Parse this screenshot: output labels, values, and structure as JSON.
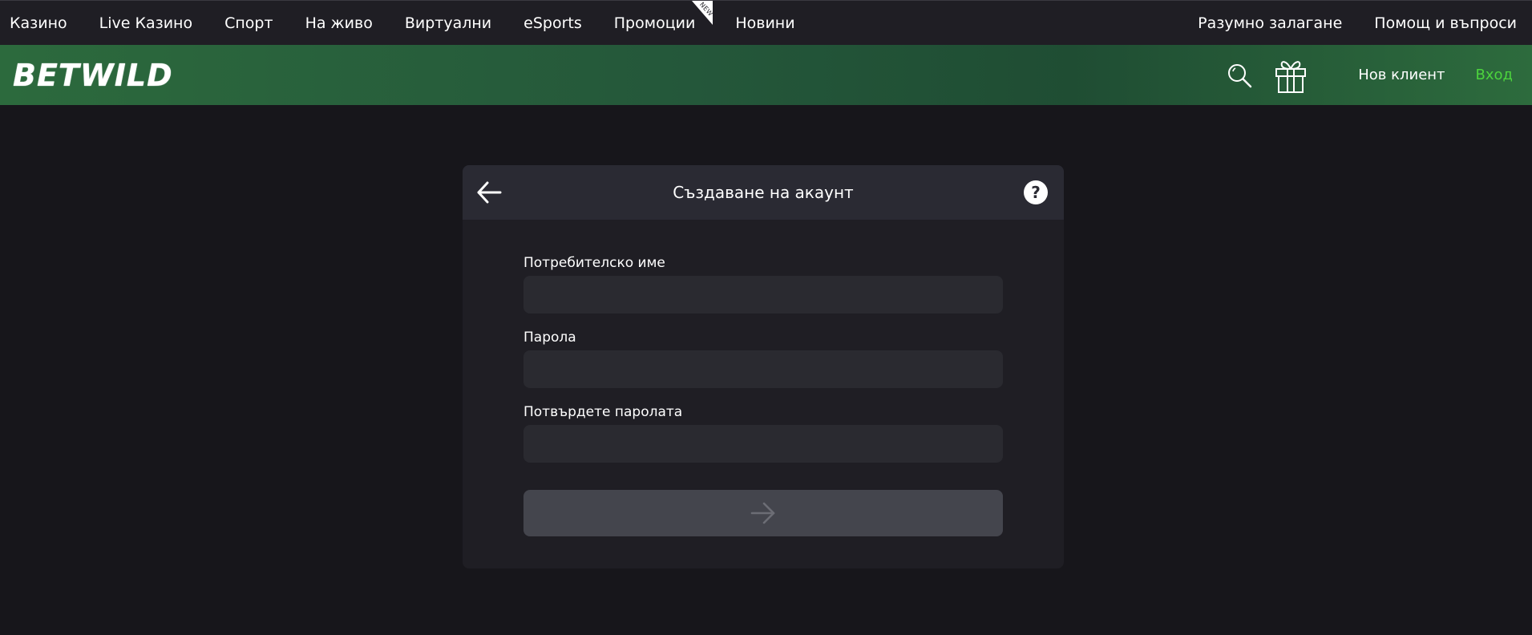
{
  "topnav": {
    "items": [
      {
        "label": "Казино"
      },
      {
        "label": "Live Казино"
      },
      {
        "label": "Спорт"
      },
      {
        "label": "На живо"
      },
      {
        "label": "Виртуални"
      },
      {
        "label": "eSports"
      },
      {
        "label": "Промоции",
        "badge": "NEW"
      },
      {
        "label": "Новини"
      }
    ],
    "right_items": [
      {
        "label": "Разумно залагане"
      },
      {
        "label": "Помощ и въпроси"
      }
    ]
  },
  "header": {
    "logo": "BETWILD",
    "search_icon": "search-icon",
    "gift_icon": "gift-icon",
    "new_client": "Нов клиент",
    "login": "Вход",
    "colors": {
      "login_accent": "#4cd43d",
      "header_green": "#24573a"
    }
  },
  "card": {
    "title": "Създаване на акаунт",
    "back_icon": "arrow-left-icon",
    "help_symbol": "?",
    "fields": [
      {
        "label": "Потребителско име",
        "value": "",
        "placeholder": ""
      },
      {
        "label": "Парола",
        "value": "",
        "placeholder": ""
      },
      {
        "label": "Потвърдете паролата",
        "value": "",
        "placeholder": ""
      }
    ],
    "submit_icon": "arrow-right-icon"
  }
}
